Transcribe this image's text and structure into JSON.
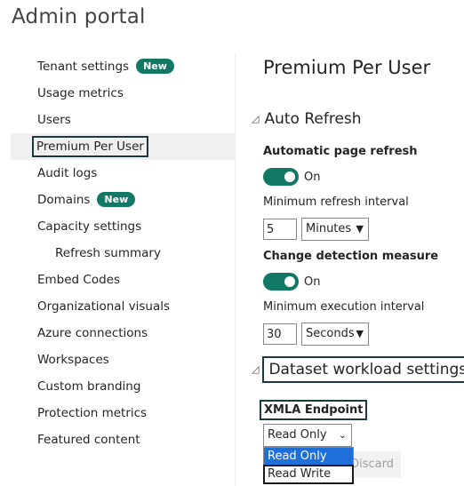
{
  "app": {
    "title": "Admin portal"
  },
  "sidebar": {
    "items": [
      {
        "label": "Tenant settings",
        "badge": "New"
      },
      {
        "label": "Usage metrics"
      },
      {
        "label": "Users"
      },
      {
        "label": "Premium Per User",
        "active": true
      },
      {
        "label": "Audit logs"
      },
      {
        "label": "Domains",
        "badge": "New"
      },
      {
        "label": "Capacity settings"
      },
      {
        "label": "Refresh summary",
        "indent": true
      },
      {
        "label": "Embed Codes"
      },
      {
        "label": "Organizational visuals"
      },
      {
        "label": "Azure connections"
      },
      {
        "label": "Workspaces"
      },
      {
        "label": "Custom branding"
      },
      {
        "label": "Protection metrics"
      },
      {
        "label": "Featured content"
      }
    ]
  },
  "main": {
    "title": "Premium Per User",
    "auto_refresh": {
      "heading": "Auto Refresh",
      "automatic_page_refresh": {
        "label": "Automatic page refresh",
        "toggle_state": "On",
        "min_interval_label": "Minimum refresh interval",
        "min_interval_value": "5",
        "min_interval_unit": "Minutes"
      },
      "change_detection": {
        "label": "Change detection measure",
        "toggle_state": "On",
        "min_exec_label": "Minimum execution interval",
        "min_exec_value": "30",
        "min_exec_unit": "Seconds"
      }
    },
    "dataset_workload": {
      "heading": "Dataset workload settings",
      "xmla_label": "XMLA Endpoint",
      "xmla_selected": "Read Only",
      "xmla_options": [
        "Read Only",
        "Read Write"
      ]
    },
    "discard_label": "Discard"
  },
  "colors": {
    "accent": "#117865",
    "selection": "#1e6fd9",
    "highlight_outline": "#1b3a3d"
  }
}
